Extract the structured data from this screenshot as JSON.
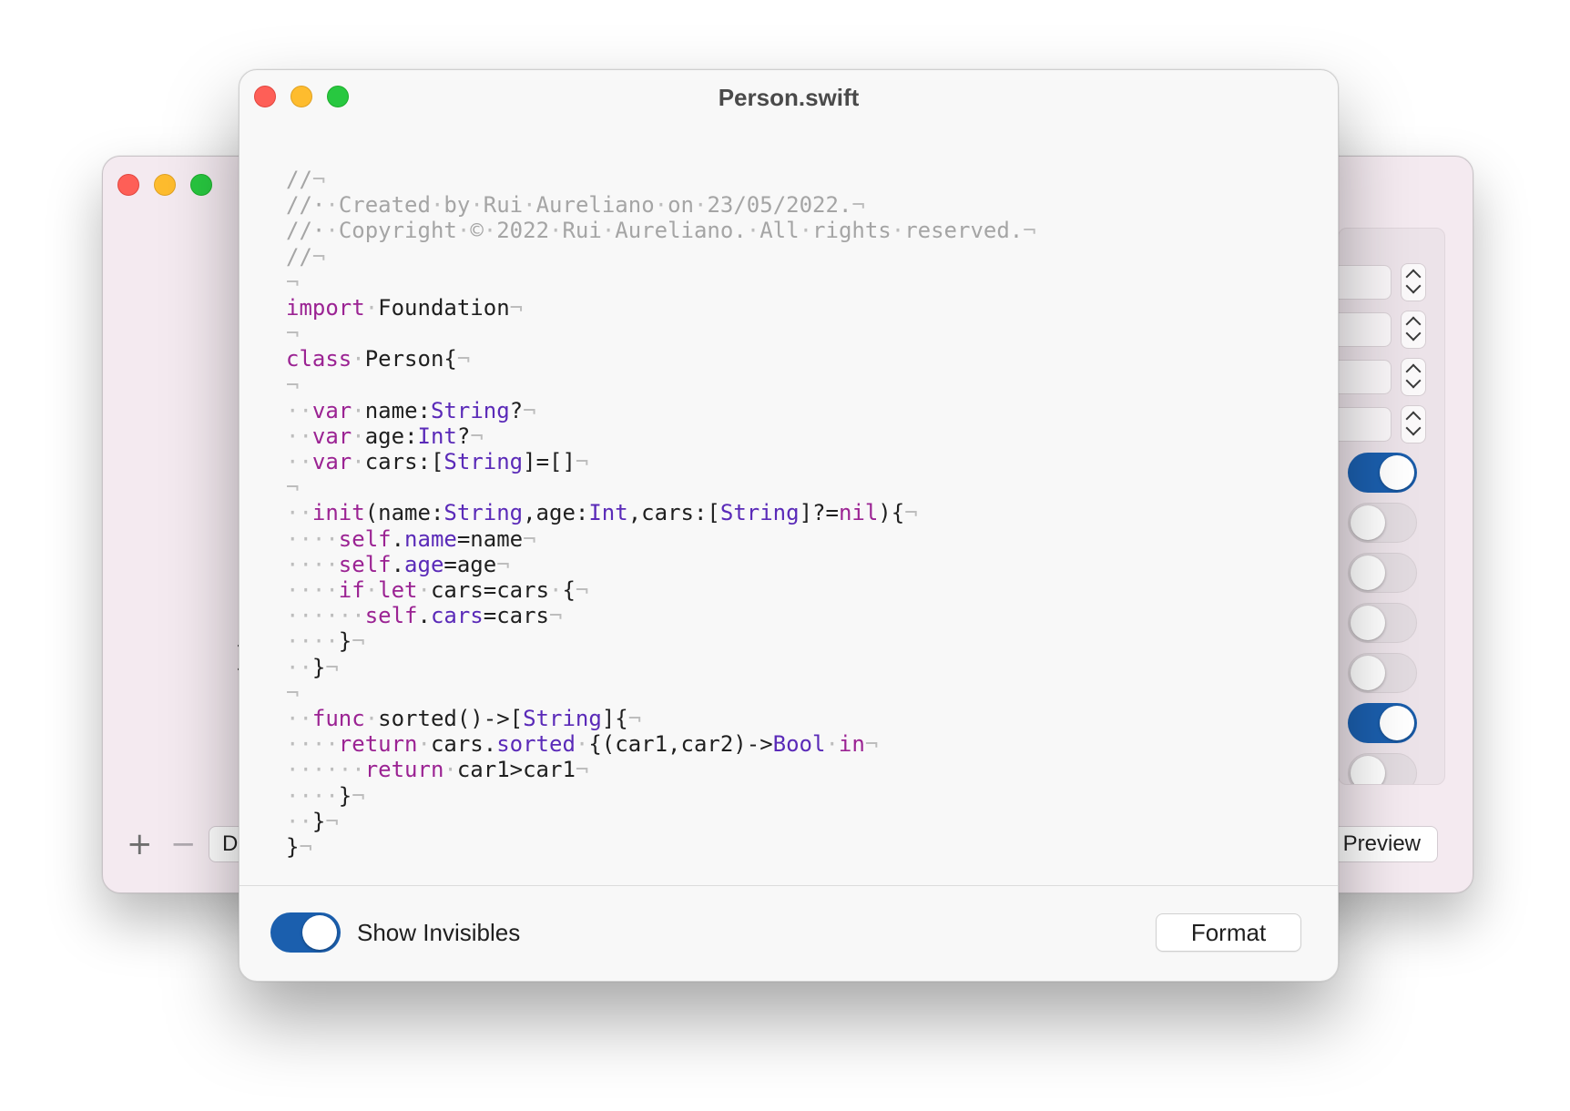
{
  "back_window": {
    "left_button_label": "D",
    "right_button_label": "Preview",
    "plus_label": "+",
    "minus_label": "−",
    "field_partial_text": ")",
    "partial_brace": "}"
  },
  "front_window": {
    "title": "Person.swift",
    "code_lines": [
      [
        [
          "cm",
          "//"
        ],
        [
          "inv",
          "¬"
        ]
      ],
      [
        [
          "cm",
          "//·"
        ],
        [
          "inv",
          "·"
        ],
        [
          "cm",
          "Created"
        ],
        [
          "inv",
          "·"
        ],
        [
          "cm",
          "by"
        ],
        [
          "inv",
          "·"
        ],
        [
          "cm",
          "Rui"
        ],
        [
          "inv",
          "·"
        ],
        [
          "cm",
          "Aureliano"
        ],
        [
          "inv",
          "·"
        ],
        [
          "cm",
          "on"
        ],
        [
          "inv",
          "·"
        ],
        [
          "cm",
          "23/05/2022."
        ],
        [
          "inv",
          "¬"
        ]
      ],
      [
        [
          "cm",
          "//·"
        ],
        [
          "inv",
          "·"
        ],
        [
          "cm",
          "Copyright"
        ],
        [
          "inv",
          "·"
        ],
        [
          "cm",
          "©"
        ],
        [
          "inv",
          "·"
        ],
        [
          "cm",
          "2022"
        ],
        [
          "inv",
          "·"
        ],
        [
          "cm",
          "Rui"
        ],
        [
          "inv",
          "·"
        ],
        [
          "cm",
          "Aureliano."
        ],
        [
          "inv",
          "·"
        ],
        [
          "cm",
          "All"
        ],
        [
          "inv",
          "·"
        ],
        [
          "cm",
          "rights"
        ],
        [
          "inv",
          "·"
        ],
        [
          "cm",
          "reserved."
        ],
        [
          "inv",
          "¬"
        ]
      ],
      [
        [
          "cm",
          "//"
        ],
        [
          "inv",
          "¬"
        ]
      ],
      [
        [
          "inv",
          "¬"
        ]
      ],
      [
        [
          "kw",
          "import"
        ],
        [
          "inv",
          "·"
        ],
        [
          "pl",
          "Foundation"
        ],
        [
          "inv",
          "¬"
        ]
      ],
      [
        [
          "inv",
          "¬"
        ]
      ],
      [
        [
          "kw",
          "class"
        ],
        [
          "inv",
          "·"
        ],
        [
          "pl",
          "Person{"
        ],
        [
          "inv",
          "¬"
        ]
      ],
      [
        [
          "inv",
          "¬"
        ]
      ],
      [
        [
          "inv",
          "··"
        ],
        [
          "kw",
          "var"
        ],
        [
          "inv",
          "·"
        ],
        [
          "pl",
          "name:"
        ],
        [
          "ty",
          "String"
        ],
        [
          "pl",
          "?"
        ],
        [
          "inv",
          "¬"
        ]
      ],
      [
        [
          "inv",
          "··"
        ],
        [
          "kw",
          "var"
        ],
        [
          "inv",
          "·"
        ],
        [
          "pl",
          "age:"
        ],
        [
          "ty",
          "Int"
        ],
        [
          "pl",
          "?"
        ],
        [
          "inv",
          "¬"
        ]
      ],
      [
        [
          "inv",
          "··"
        ],
        [
          "kw",
          "var"
        ],
        [
          "inv",
          "·"
        ],
        [
          "pl",
          "cars:["
        ],
        [
          "ty",
          "String"
        ],
        [
          "pl",
          "]=[]"
        ],
        [
          "inv",
          "¬"
        ]
      ],
      [
        [
          "inv",
          "¬"
        ]
      ],
      [
        [
          "inv",
          "··"
        ],
        [
          "kw",
          "init"
        ],
        [
          "pl",
          "(name:"
        ],
        [
          "ty",
          "String"
        ],
        [
          "pl",
          ",age:"
        ],
        [
          "ty",
          "Int"
        ],
        [
          "pl",
          ",cars:["
        ],
        [
          "ty",
          "String"
        ],
        [
          "pl",
          "]?="
        ],
        [
          "kw",
          "nil"
        ],
        [
          "pl",
          "){"
        ],
        [
          "inv",
          "¬"
        ]
      ],
      [
        [
          "inv",
          "····"
        ],
        [
          "kw",
          "self"
        ],
        [
          "pl",
          "."
        ],
        [
          "ty",
          "name"
        ],
        [
          "pl",
          "=name"
        ],
        [
          "inv",
          "¬"
        ]
      ],
      [
        [
          "inv",
          "····"
        ],
        [
          "kw",
          "self"
        ],
        [
          "pl",
          "."
        ],
        [
          "ty",
          "age"
        ],
        [
          "pl",
          "=age"
        ],
        [
          "inv",
          "¬"
        ]
      ],
      [
        [
          "inv",
          "····"
        ],
        [
          "kw",
          "if"
        ],
        [
          "inv",
          "·"
        ],
        [
          "kw",
          "let"
        ],
        [
          "inv",
          "·"
        ],
        [
          "pl",
          "cars=cars"
        ],
        [
          "inv",
          "·"
        ],
        [
          "pl",
          "{"
        ],
        [
          "inv",
          "¬"
        ]
      ],
      [
        [
          "inv",
          "······"
        ],
        [
          "kw",
          "self"
        ],
        [
          "pl",
          "."
        ],
        [
          "ty",
          "cars"
        ],
        [
          "pl",
          "=cars"
        ],
        [
          "inv",
          "¬"
        ]
      ],
      [
        [
          "inv",
          "····"
        ],
        [
          "pl",
          "}"
        ],
        [
          "inv",
          "¬"
        ]
      ],
      [
        [
          "inv",
          "··"
        ],
        [
          "pl",
          "}"
        ],
        [
          "inv",
          "¬"
        ]
      ],
      [
        [
          "inv",
          "¬"
        ]
      ],
      [
        [
          "inv",
          "··"
        ],
        [
          "kw",
          "func"
        ],
        [
          "inv",
          "·"
        ],
        [
          "pl",
          "sorted()->["
        ],
        [
          "ty",
          "String"
        ],
        [
          "pl",
          "]{"
        ],
        [
          "inv",
          "¬"
        ]
      ],
      [
        [
          "inv",
          "····"
        ],
        [
          "kw",
          "return"
        ],
        [
          "inv",
          "·"
        ],
        [
          "pl",
          "cars."
        ],
        [
          "ty",
          "sorted"
        ],
        [
          "inv",
          "·"
        ],
        [
          "pl",
          "{(car1,car2)->"
        ],
        [
          "ty",
          "Bool"
        ],
        [
          "inv",
          "·"
        ],
        [
          "kw",
          "in"
        ],
        [
          "inv",
          "¬"
        ]
      ],
      [
        [
          "inv",
          "······"
        ],
        [
          "kw",
          "return"
        ],
        [
          "inv",
          "·"
        ],
        [
          "pl",
          "car1>car1"
        ],
        [
          "inv",
          "¬"
        ]
      ],
      [
        [
          "inv",
          "····"
        ],
        [
          "pl",
          "}"
        ],
        [
          "inv",
          "¬"
        ]
      ],
      [
        [
          "inv",
          "··"
        ],
        [
          "pl",
          "}"
        ],
        [
          "inv",
          "¬"
        ]
      ],
      [
        [
          "pl",
          "}"
        ],
        [
          "inv",
          "¬"
        ]
      ]
    ],
    "show_invisibles_label": "Show Invisibles",
    "show_invisibles_on": true,
    "format_button_label": "Format"
  }
}
